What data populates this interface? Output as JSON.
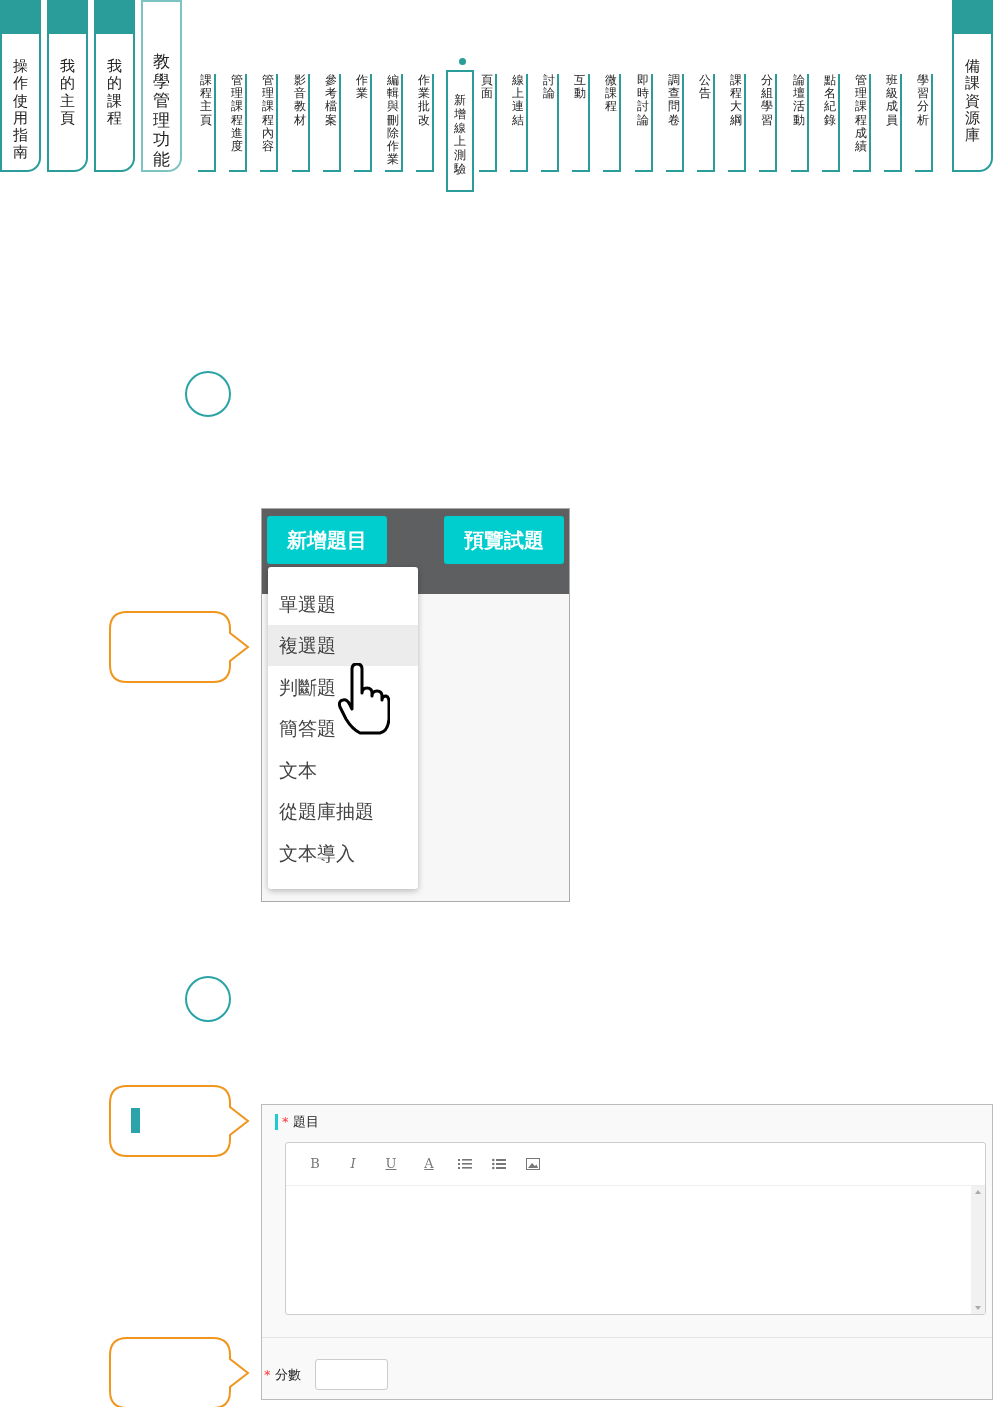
{
  "nav": {
    "main_tabs": [
      {
        "label": "操作使用指南",
        "selected": false
      },
      {
        "label": "我的主頁",
        "selected": false
      },
      {
        "label": "我的課程",
        "selected": false
      },
      {
        "label": "教學管理功能",
        "selected": true
      }
    ],
    "sub_tabs": [
      {
        "label": "課程主頁",
        "selected": false
      },
      {
        "label": "管理課程進度",
        "selected": false
      },
      {
        "label": "管理課程內容",
        "selected": false
      },
      {
        "label": "影音教材",
        "selected": false
      },
      {
        "label": "參考檔案",
        "selected": false
      },
      {
        "label": "作業",
        "selected": false
      },
      {
        "label": "編輯與刪除作業",
        "selected": false
      },
      {
        "label": "作業批改",
        "selected": false
      },
      {
        "label": "新增線上測驗",
        "selected": true
      },
      {
        "label": "頁面",
        "selected": false
      },
      {
        "label": "線上連結",
        "selected": false
      },
      {
        "label": "討論",
        "selected": false
      },
      {
        "label": "互動",
        "selected": false
      },
      {
        "label": "微課程",
        "selected": false
      },
      {
        "label": "即時討論",
        "selected": false
      },
      {
        "label": "調查問卷",
        "selected": false
      },
      {
        "label": "公告",
        "selected": false
      },
      {
        "label": "課程大綱",
        "selected": false
      },
      {
        "label": "分組學習",
        "selected": false
      },
      {
        "label": "論壇活動",
        "selected": false
      },
      {
        "label": "點名紀錄",
        "selected": false
      },
      {
        "label": "管理課程成績",
        "selected": false
      },
      {
        "label": "班級成員",
        "selected": false
      },
      {
        "label": "學習分析",
        "selected": false
      }
    ],
    "right_tab": {
      "label": "備課資源庫",
      "selected": false
    }
  },
  "step1": {
    "buttons": [
      "新增題目",
      "預覽試題"
    ],
    "menu": [
      {
        "label": "單選題",
        "selected": false
      },
      {
        "label": "複選題",
        "selected": true
      },
      {
        "label": "判斷題",
        "selected": false
      },
      {
        "label": "簡答題",
        "selected": false
      },
      {
        "label": "文本",
        "selected": false
      },
      {
        "label": "從題庫抽題",
        "selected": false
      },
      {
        "label": "文本導入",
        "selected": false
      }
    ]
  },
  "step2": {
    "required_mark": "*",
    "question_label": "題目",
    "toolbar": [
      "B",
      "I",
      "U",
      "A"
    ],
    "score_label": "分數"
  }
}
